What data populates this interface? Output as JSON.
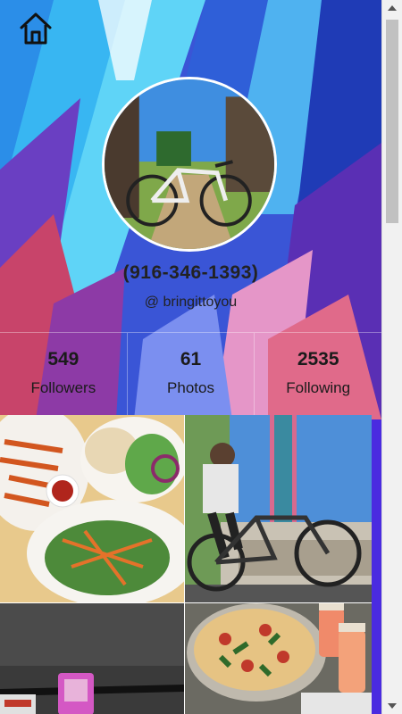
{
  "profile": {
    "phone": "(916-346-1393)",
    "handle": "@ bringittoyou"
  },
  "stats": [
    {
      "value": "549",
      "label": "Followers"
    },
    {
      "value": "61",
      "label": "Photos"
    },
    {
      "value": "2535",
      "label": "Following"
    }
  ],
  "icons": {
    "home": "home-icon",
    "scroll_up": "arrow-up-icon",
    "scroll_down": "arrow-down-icon"
  },
  "colors": {
    "bg_blue": "#2d6fe0",
    "bg_purple": "#5b2bb0",
    "bg_red": "#c23a5e",
    "bg_cyan": "#35c8f2"
  }
}
